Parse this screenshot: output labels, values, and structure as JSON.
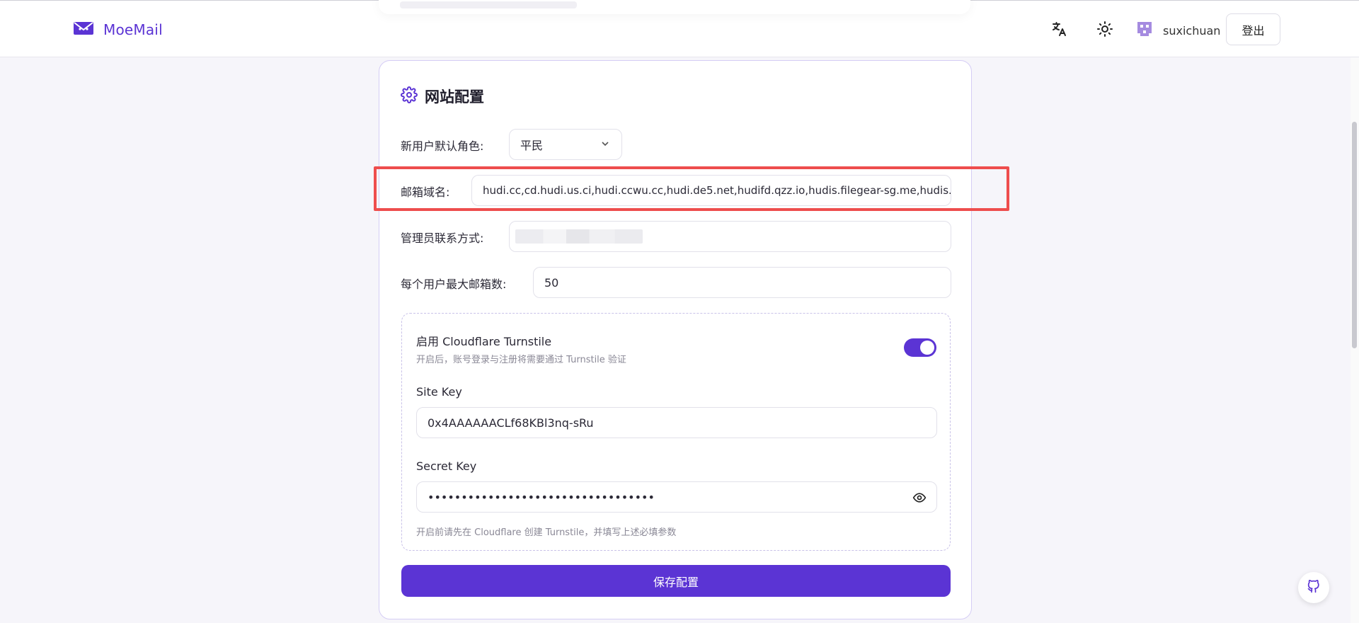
{
  "header": {
    "app_name": "MoeMail",
    "user_name": "suxichuan",
    "logout_label": "登出",
    "icons": [
      "moemail-logo-icon",
      "translate-icon",
      "sun-icon",
      "avatar"
    ]
  },
  "settings": {
    "title": "网站配置",
    "default_role_label": "新用户默认角色:",
    "default_role_value": "平民",
    "email_domains_label": "邮箱域名:",
    "email_domains_value": "hudi.cc,cd.hudi.us.ci,hudi.ccwu.cc,hudi.de5.net,hudifd.qzz.io,hudis.filegear-sg.me,hudis.dpdns.o",
    "admin_contact_label": "管理员联系方式:",
    "max_emails_label": "每个用户最大邮箱数:",
    "max_emails_value": "50"
  },
  "turnstile": {
    "title": "启用 Cloudflare Turnstile",
    "description": "开启后，账号登录与注册将需要通过 Turnstile 验证",
    "enabled": true,
    "site_key_label": "Site Key",
    "site_key_value": "0x4AAAAAACLf68KBl3nq-sRu",
    "secret_key_label": "Secret Key",
    "secret_key_value": "••••••••••••••••••••••••••••••••••",
    "hint": "开启前请先在 Cloudflare 创建 Turnstile，并填写上述必填参数"
  },
  "actions": {
    "save_label": "保存配置"
  },
  "colors": {
    "accent": "#5b34d4",
    "highlight": "#ee4d4d"
  }
}
